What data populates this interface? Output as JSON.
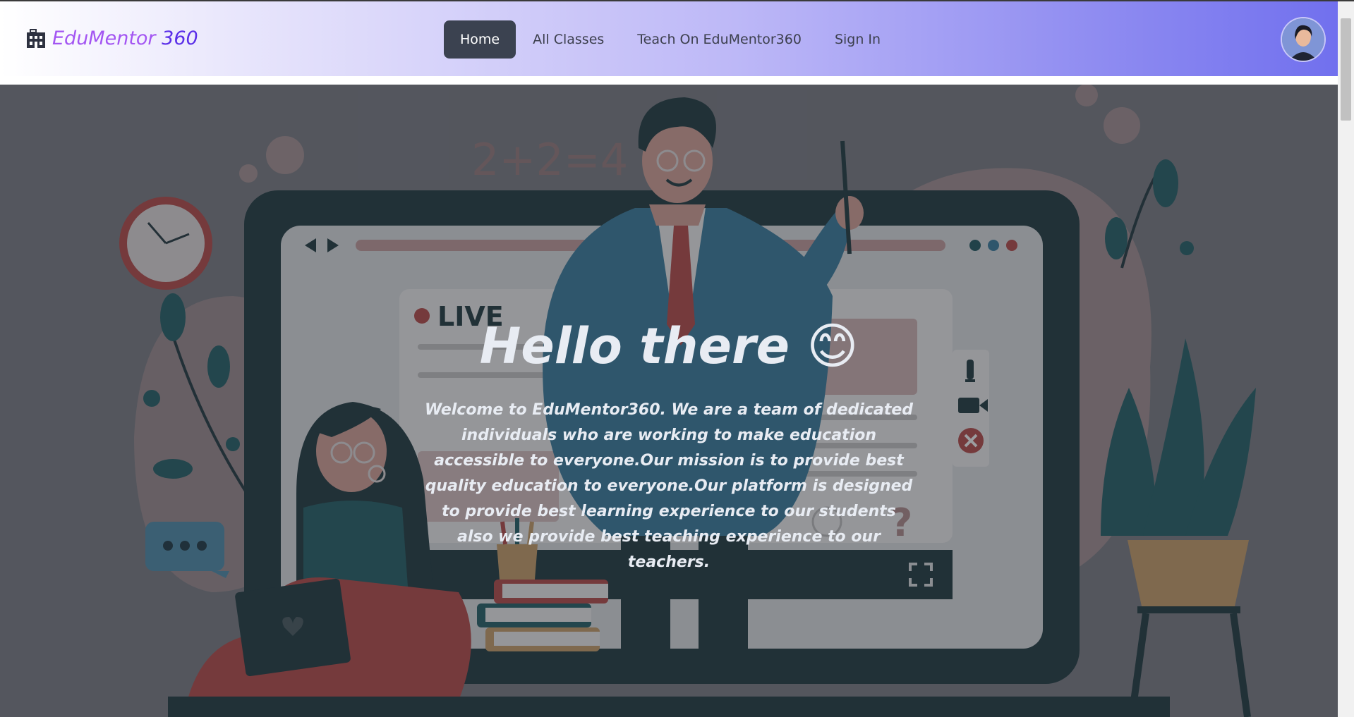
{
  "brand": {
    "name": "EduMentor",
    "number": "360",
    "icon": "school-building-icon"
  },
  "nav": {
    "items": [
      {
        "label": "Home",
        "active": true
      },
      {
        "label": "All Classes",
        "active": false
      },
      {
        "label": "Teach On EduMentor360",
        "active": false
      },
      {
        "label": "Sign In",
        "active": false
      }
    ]
  },
  "user": {
    "avatar": "user-avatar"
  },
  "hero": {
    "title": "Hello there 😊",
    "description": "Welcome to EduMentor360. We are a team of dedicated individuals who are working to make education accessible to everyone.Our mission is to provide best quality education to everyone.Our platform is designed to provide best learning experience to our students also we provide best teaching experience to our teachers.",
    "illustration": {
      "equation": "2+2=4",
      "live_label": "LIVE"
    }
  },
  "colors": {
    "accent": "#a355f2",
    "accent_dark": "#5a2ee8",
    "nav_active_bg": "#3b4250"
  }
}
